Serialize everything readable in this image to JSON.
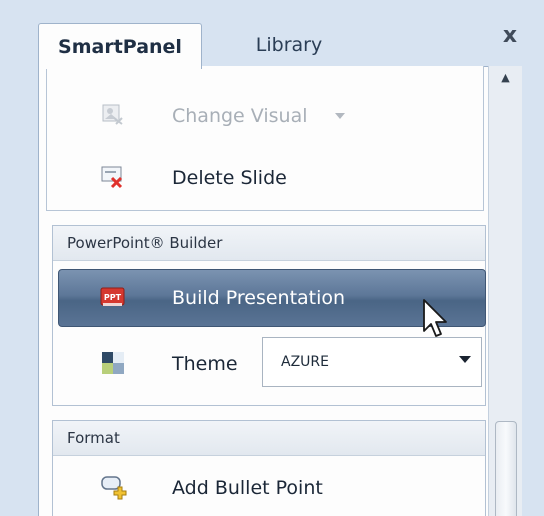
{
  "tabs": {
    "active": "SmartPanel",
    "inactive": "Library",
    "close": "x"
  },
  "actions": {
    "change_visual": "Change Visual",
    "delete_slide": "Delete Slide"
  },
  "builder": {
    "header": "PowerPoint® Builder",
    "build_presentation": "Build Presentation",
    "theme_label": "Theme",
    "theme_value": "AZURE"
  },
  "format": {
    "header": "Format",
    "add_bullet": "Add Bullet Point"
  },
  "icons": {
    "change_visual": "image-icon",
    "delete_slide": "delete-slide-icon",
    "build_presentation": "powerpoint-icon",
    "theme": "theme-icon",
    "add_bullet": "add-bullet-icon"
  },
  "colors": {
    "panel_bg": "#d7e3f1",
    "highlight": "#5d7798",
    "section_header": "#e2e8ef"
  }
}
